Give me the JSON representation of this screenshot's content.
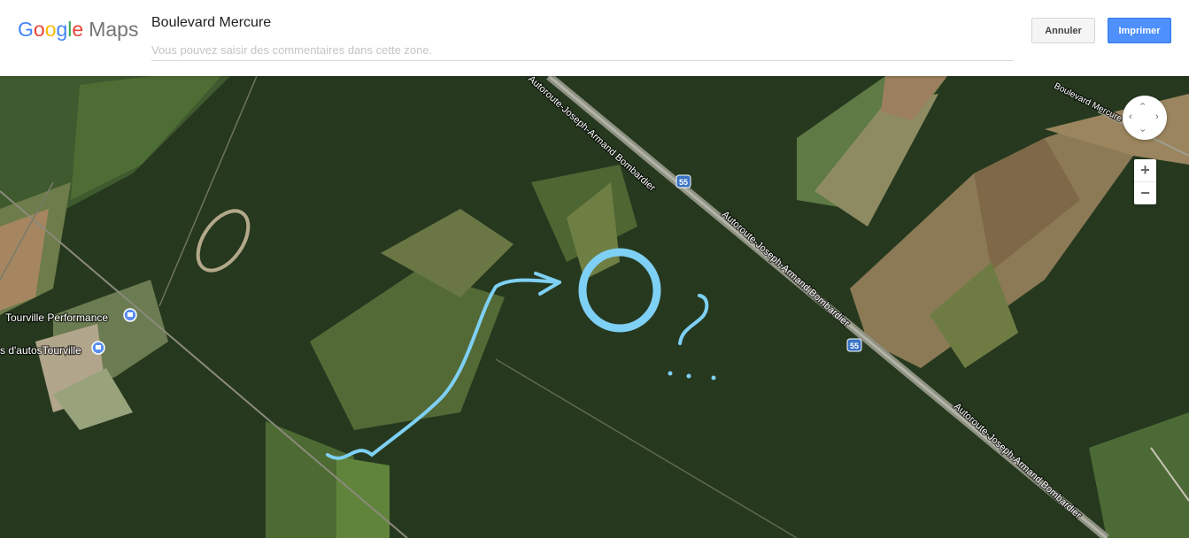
{
  "header": {
    "logo": {
      "google": "Google",
      "maps": "Maps"
    },
    "title": "Boulevard Mercure",
    "comment_placeholder": "Vous pouvez saisir des commentaires dans cette zone.",
    "cancel_label": "Annuler",
    "print_label": "Imprimer"
  },
  "map": {
    "labels": {
      "road_top": "Autoroute-Joseph-Armand Bombardier",
      "road_mid": "Autoroute-Joseph-Armand Bombardier",
      "road_low": "Autoroute-Joseph-Armand Bombardier",
      "boulevard": "Boulevard Mercure",
      "shield_1": "55",
      "shield_2": "55",
      "poi_1": "Tourville Performance",
      "poi_2": "s d'autosTourville"
    }
  },
  "controls": {
    "zoom_in": "+",
    "zoom_out": "−",
    "pan_icons": [
      "‹",
      "›",
      "‹",
      "›"
    ]
  },
  "colors": {
    "annotation": "#7fd0f5",
    "print_button": "#4d90fe",
    "forest": "#26391f"
  }
}
